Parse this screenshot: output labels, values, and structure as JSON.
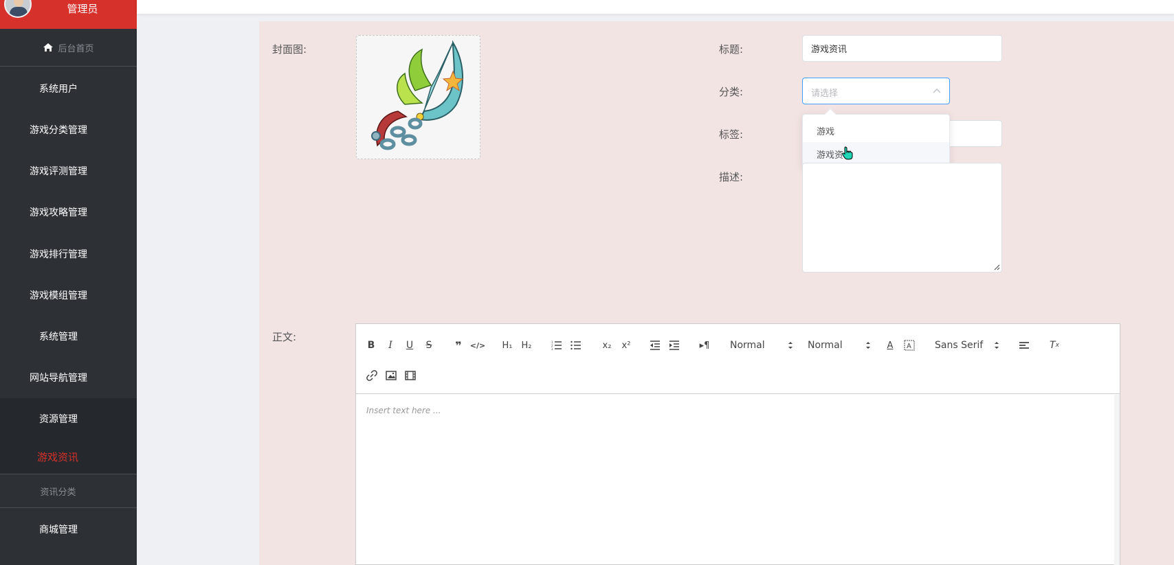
{
  "sidebar": {
    "admin_name": "管理员",
    "home_label": "后台首页",
    "items": [
      {
        "label": "系统用户"
      },
      {
        "label": "游戏分类管理"
      },
      {
        "label": "游戏评测管理"
      },
      {
        "label": "游戏攻略管理"
      },
      {
        "label": "游戏排行管理"
      },
      {
        "label": "游戏模组管理"
      },
      {
        "label": "系统管理"
      },
      {
        "label": "网站导航管理"
      },
      {
        "label": "资源管理"
      }
    ],
    "active_item": "游戏资讯",
    "sub_item": "资讯分类",
    "last_item": "商城管理",
    "accent_color": "#d6312b"
  },
  "form": {
    "cover_label": "封面图:",
    "title_label": "标题:",
    "title_value": "游戏资讯",
    "category_label": "分类:",
    "category_placeholder": "请选择",
    "category_options": [
      "游戏",
      "游戏资讯"
    ],
    "tags_label": "标签:",
    "desc_label": "描述:",
    "body_label": "正文:"
  },
  "editor": {
    "header_select_1": "Normal",
    "header_select_2": "Normal",
    "font_select": "Sans Serif",
    "placeholder": "Insert text here ..."
  }
}
